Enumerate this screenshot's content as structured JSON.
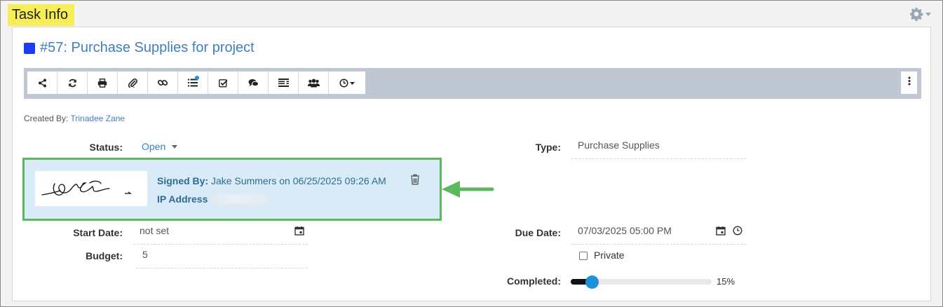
{
  "section": {
    "title": "Task Info"
  },
  "task": {
    "title": "#57: Purchase Supplies for project",
    "color": "#1d3cf0"
  },
  "toolbar": {
    "buttons": [
      "share-icon",
      "refresh-icon",
      "print-icon",
      "paperclip-icon",
      "link-icon",
      "list-icon",
      "checkbox-icon",
      "comments-icon",
      "tasks-icon",
      "users-icon",
      "clock-icon"
    ]
  },
  "meta": {
    "created_by_label": "Created By:",
    "created_by_name": "Trinadee Zane"
  },
  "status": {
    "label": "Status:",
    "value": "Open"
  },
  "type": {
    "label": "Type:",
    "value": "Purchase Supplies"
  },
  "signature": {
    "signed_by_label": "Signed By:",
    "signed_by_value": "Jake Summers on 06/25/2025 09:26 AM",
    "ip_label": "IP Address"
  },
  "start_date": {
    "label": "Start Date:",
    "value": "not set"
  },
  "budget": {
    "label": "Budget:",
    "value": "5"
  },
  "due_date": {
    "label": "Due Date:",
    "value": "07/03/2025 05:00 PM"
  },
  "private": {
    "label": "Private",
    "checked": false
  },
  "completed": {
    "label": "Completed:",
    "value_text": "15%",
    "percent": 15
  },
  "colors": {
    "accent": "#3f7fbf",
    "highlight": "#f5ee57",
    "signature_bg": "#d9ebf6",
    "callout": "#5cb85c",
    "slider_thumb": "#1e8fd9"
  }
}
